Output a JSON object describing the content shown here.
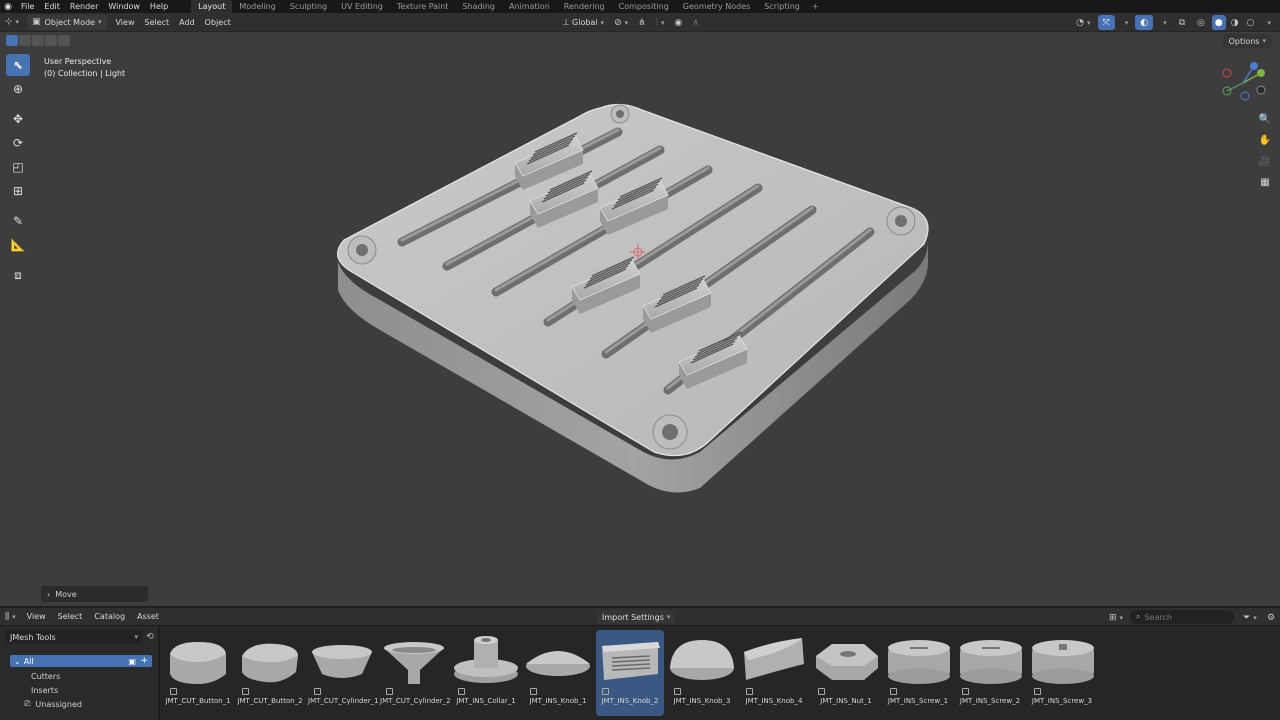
{
  "topbar": {
    "menus": [
      "File",
      "Edit",
      "Render",
      "Window",
      "Help"
    ],
    "workspaces": [
      "Layout",
      "Modeling",
      "Sculpting",
      "UV Editing",
      "Texture Paint",
      "Shading",
      "Animation",
      "Rendering",
      "Compositing",
      "Geometry Nodes",
      "Scripting"
    ],
    "active_workspace": "Layout",
    "add_tab": "+"
  },
  "header": {
    "mode": "Object Mode",
    "menus": [
      "View",
      "Select",
      "Add",
      "Object"
    ],
    "transform_orientation": "Global"
  },
  "viewport": {
    "options": "Options",
    "perspective": "User Perspective",
    "collection": "(0) Collection | Light",
    "gizmo_axes": [
      "X",
      "Y",
      "Z"
    ],
    "last_operator": "Move"
  },
  "asset_browser": {
    "menus": [
      "View",
      "Select",
      "Catalog",
      "Asset"
    ],
    "import_settings": "Import Settings",
    "search_placeholder": "Search",
    "library": "JMesh Tools",
    "catalogs": {
      "all": "All",
      "children": [
        "Cutters",
        "Inserts"
      ],
      "unassigned": "Unassigned"
    },
    "assets": [
      {
        "label": "JMT_CUT_Button_1",
        "shape": "button1",
        "selected": false
      },
      {
        "label": "JMT_CUT_Button_2",
        "shape": "button2",
        "selected": false
      },
      {
        "label": "JMT_CUT_Cylinder_1",
        "shape": "cyl1",
        "selected": false
      },
      {
        "label": "JMT_CUT_Cylinder_2",
        "shape": "cyl2",
        "selected": false
      },
      {
        "label": "JMT_INS_Collar_1",
        "shape": "collar",
        "selected": false
      },
      {
        "label": "JMT_INS_Knob_1",
        "shape": "knob1",
        "selected": false
      },
      {
        "label": "JMT_INS_Knob_2",
        "shape": "knob2",
        "selected": true
      },
      {
        "label": "JMT_INS_Knob_3",
        "shape": "knob3",
        "selected": false
      },
      {
        "label": "JMT_INS_Knob_4",
        "shape": "knob4",
        "selected": false
      },
      {
        "label": "JMT_INS_Nut_1",
        "shape": "nut",
        "selected": false
      },
      {
        "label": "JMT_INS_Screw_1",
        "shape": "screw",
        "selected": false
      },
      {
        "label": "JMT_INS_Screw_2",
        "shape": "screw",
        "selected": false
      },
      {
        "label": "JMT_INS_Screw_3",
        "shape": "screw3",
        "selected": false
      }
    ]
  },
  "colors": {
    "accent": "#4772b3",
    "viewport_bg": "#3d3d3d",
    "model": "#bdbdbd"
  }
}
